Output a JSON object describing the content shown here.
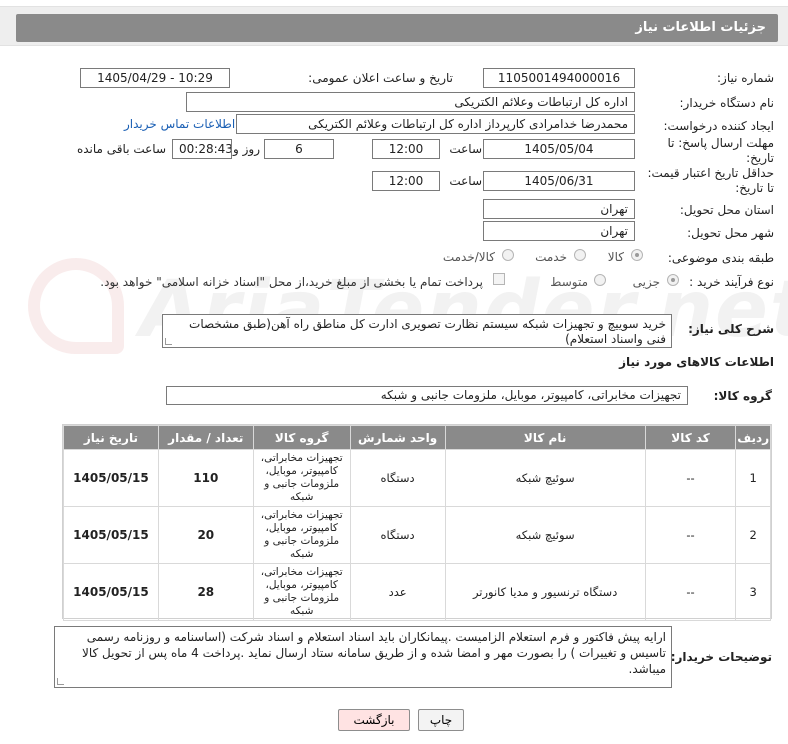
{
  "header": {
    "title": "جزئیات اطلاعات نیاز"
  },
  "form": {
    "need_number_label": "شماره نیاز:",
    "need_number": "1105001494000016",
    "announce_label": "تاریخ و ساعت اعلان عمومی:",
    "announce_value": "1405/04/29 - 10:29",
    "buyer_org_label": "نام دستگاه خریدار:",
    "buyer_org": "اداره کل ارتباطات وعلائم الکتریکی",
    "creator_label": "ایجاد کننده درخواست:",
    "creator": "محمدرضا خدامرادی کارپرداز اداره کل ارتباطات وعلائم الکتریکی",
    "contact_link": "اطلاعات تماس خریدار",
    "reply_deadline_label": "مهلت ارسال پاسخ: تا تاریخ:",
    "reply_date": "1405/05/04",
    "time_label": "ساعت",
    "reply_time": "12:00",
    "days_value": "6",
    "days_label": "روز و",
    "remaining_time": "00:28:43",
    "remaining_label": "ساعت باقی مانده",
    "price_validity_label": "حداقل تاریخ اعتبار قیمت: تا تاریخ:",
    "price_date": "1405/06/31",
    "price_time_label": "ساعت",
    "price_time": "12:00",
    "province_label": "استان محل تحویل:",
    "province": "تهران",
    "city_label": "شهر محل تحویل:",
    "city": "تهران",
    "category_label": "طبقه بندی موضوعی:",
    "category_options": [
      "کالا",
      "خدمت",
      "کالا/خدمت"
    ],
    "process_label": "نوع فرآیند خرید :",
    "process_options": [
      "جزیی",
      "متوسط"
    ],
    "payment_text": "پرداخت تمام یا بخشی از مبلغ خرید،از محل \"اسناد خزانه اسلامی\" خواهد بود."
  },
  "summary": {
    "label": "شرح کلی نیاز:",
    "text": "خرید سوییچ و تجهیزات شبکه سیستم نظارت تصویری ادارت کل مناطق راه آهن(طبق مشخصات فنی واسناد استعلام)"
  },
  "goods": {
    "section_title": "اطلاعات کالاهای مورد نیاز",
    "group_label": "گروه کالا:",
    "group_value": "تجهیزات مخابراتی، کامپیوتر، موبایل، ملزومات جانبی و شبکه",
    "columns": [
      "ردیف",
      "کد کالا",
      "نام کالا",
      "واحد شمارش",
      "گروه کالا",
      "تعداد / مقدار",
      "تاریخ نیاز"
    ],
    "rows": [
      {
        "row": "1",
        "code": "--",
        "name": "سوئیچ شبکه",
        "unit": "دستگاه",
        "group": "تجهیزات مخابراتی، کامپیوتر، موبایل، ملزومات جانبی و شبکه",
        "qty": "110",
        "date": "1405/05/15"
      },
      {
        "row": "2",
        "code": "--",
        "name": "سوئیچ شبکه",
        "unit": "دستگاه",
        "group": "تجهیزات مخابراتی، کامپیوتر، موبایل، ملزومات جانبی و شبکه",
        "qty": "20",
        "date": "1405/05/15"
      },
      {
        "row": "3",
        "code": "--",
        "name": "دستگاه ترنسیور و مدیا کانورتر",
        "unit": "عدد",
        "group": "تجهیزات مخابراتی، کامپیوتر، موبایل، ملزومات جانبی و شبکه",
        "qty": "28",
        "date": "1405/05/15"
      }
    ]
  },
  "buyer_notes": {
    "label": "توضیحات خریدار:",
    "text": "ارایه پیش فاکتور و فرم استعلام الزامیست .پیمانکاران باید اسناد استعلام و اسناد شرکت (اساسنامه و روزنامه رسمی تاسیس و تغییرات ) را بصورت مهر و امضا شده و از طریق سامانه ستاد ارسال نماید .پرداخت 4 ماه پس از تحویل کالا میباشد."
  },
  "buttons": {
    "print": "چاپ",
    "back": "بازگشت"
  },
  "watermark": {
    "text": "AriaTender.net"
  }
}
